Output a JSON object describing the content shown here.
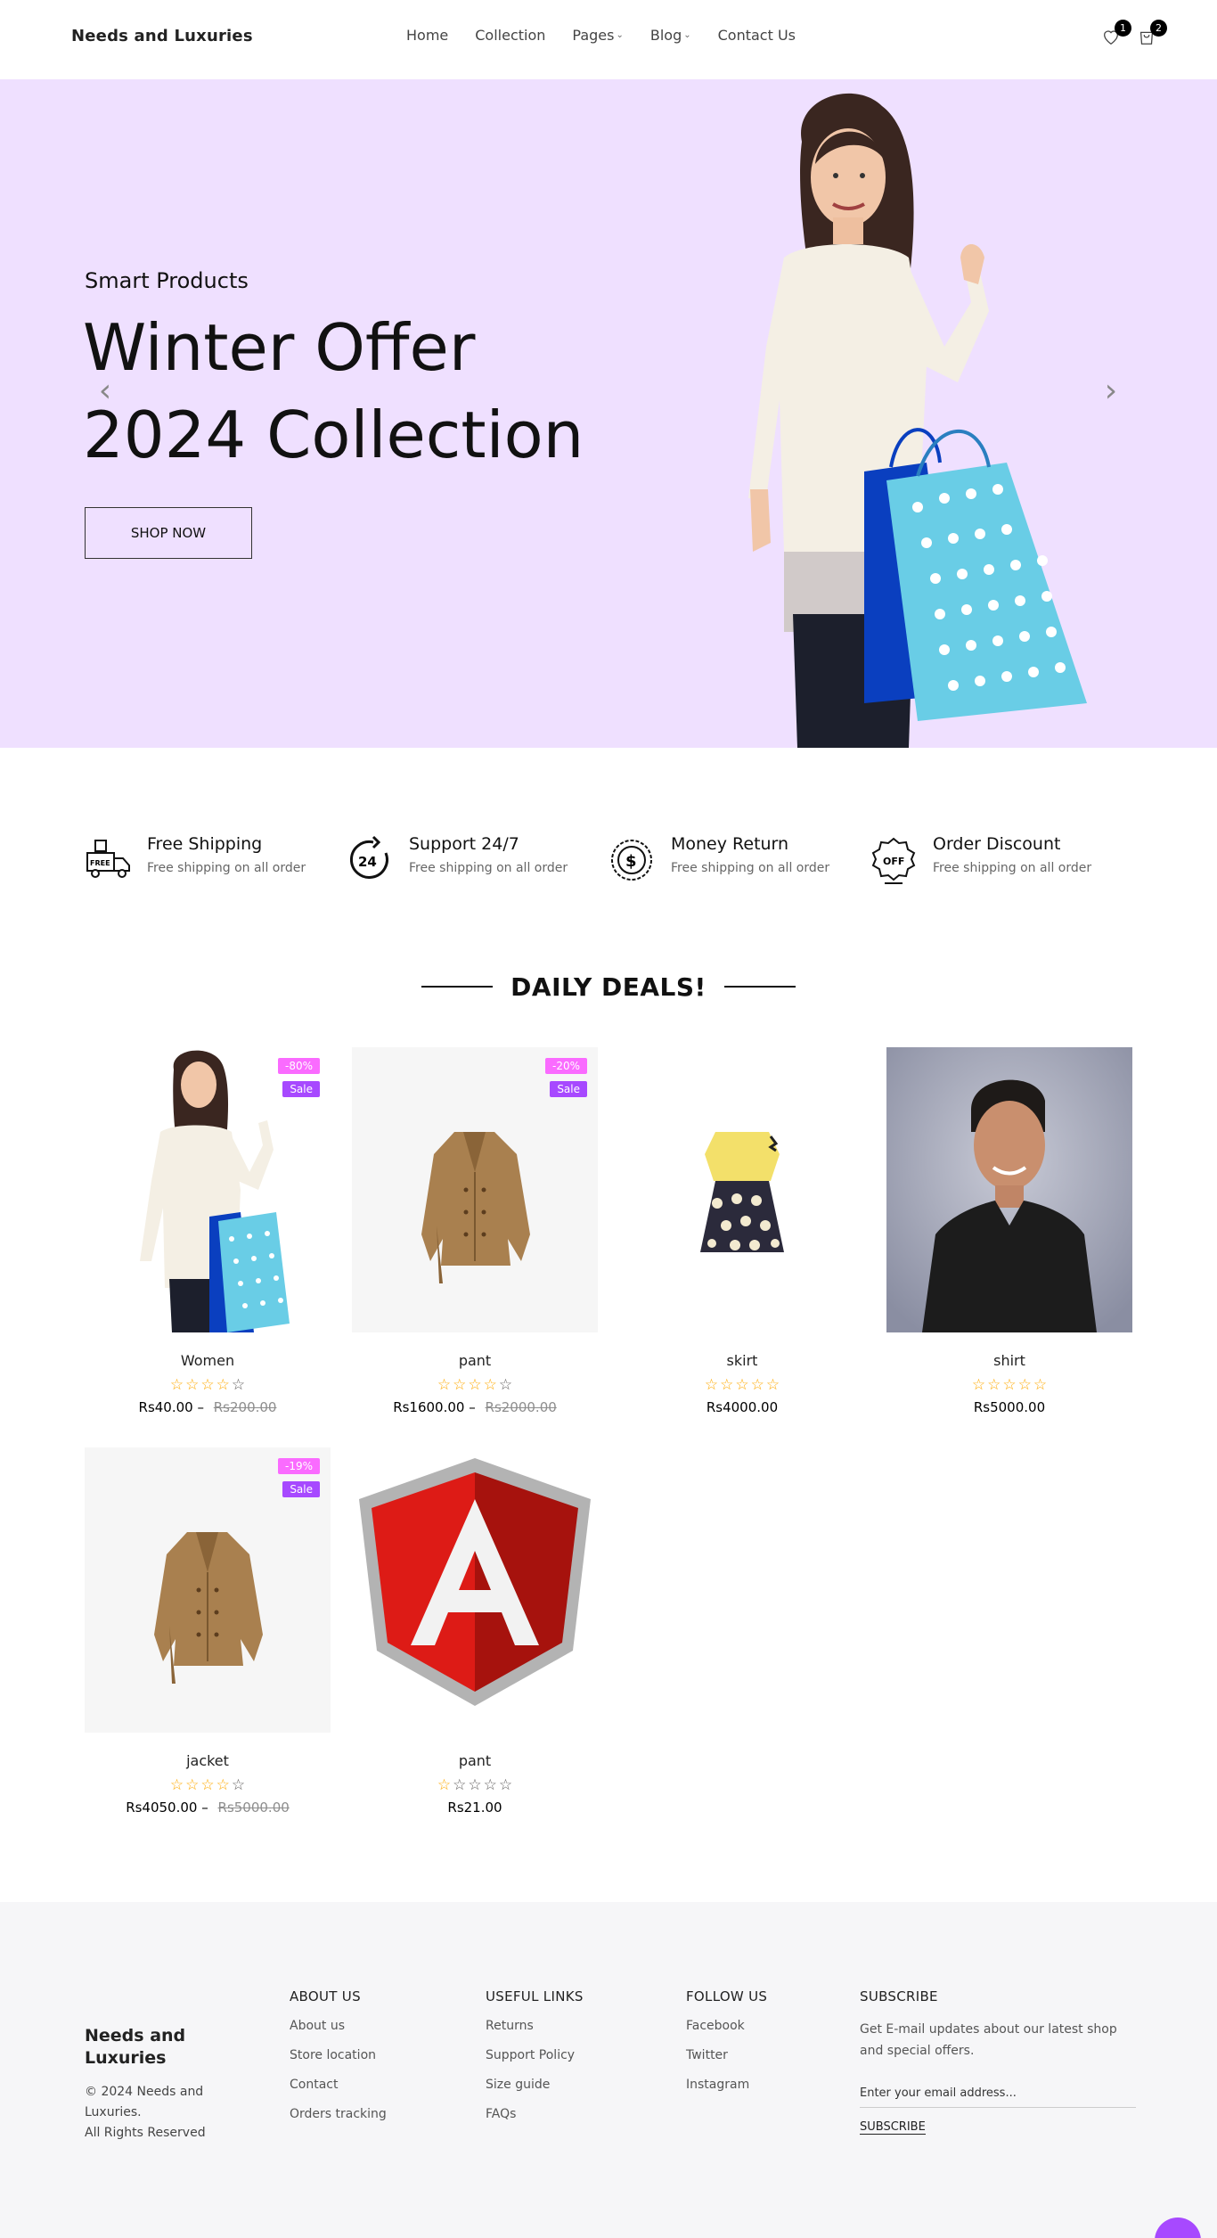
{
  "header": {
    "logo": "Needs and Luxuries",
    "nav": [
      {
        "label": "Home",
        "dropdown": false
      },
      {
        "label": "Collection",
        "dropdown": false
      },
      {
        "label": "Pages",
        "dropdown": true
      },
      {
        "label": "Blog",
        "dropdown": true
      },
      {
        "label": "Contact Us",
        "dropdown": false
      }
    ],
    "wishlist_count": "1",
    "cart_count": "2"
  },
  "hero": {
    "subtitle": "Smart Products",
    "title_line1": "Winter Offer",
    "title_line2": "2024 Collection",
    "button": "SHOP NOW",
    "background": "#efe0ff"
  },
  "features": [
    {
      "icon": "free-shipping-truck-icon",
      "title": "Free Shipping",
      "desc": "Free shipping on all order"
    },
    {
      "icon": "support-24-7-icon",
      "title": "Support 24/7",
      "desc": "Free shipping on all order"
    },
    {
      "icon": "money-return-icon",
      "title": "Money Return",
      "desc": "Free shipping on all order"
    },
    {
      "icon": "order-discount-icon",
      "title": "Order Discount",
      "desc": "Free shipping on all order"
    }
  ],
  "deals": {
    "heading": "DAILY DEALS!",
    "products": [
      {
        "name": "Women",
        "rating": 4,
        "price": "Rs40.00",
        "old_price": "Rs200.00",
        "discount": "-80%",
        "sale": "Sale",
        "image": "woman-with-shopping-bags"
      },
      {
        "name": "pant",
        "rating": 4,
        "price": "Rs1600.00",
        "old_price": "Rs2000.00",
        "discount": "-20%",
        "sale": "Sale",
        "image": "brown-coat"
      },
      {
        "name": "skirt",
        "rating": 5,
        "price": "Rs4000.00",
        "old_price": "",
        "discount": "",
        "sale": "",
        "image": "yellow-dress"
      },
      {
        "name": "shirt",
        "rating": 5,
        "price": "Rs5000.00",
        "old_price": "",
        "discount": "",
        "sale": "",
        "image": "person-portrait"
      },
      {
        "name": "jacket",
        "rating": 4,
        "price": "Rs4050.00",
        "old_price": "Rs5000.00",
        "discount": "-19%",
        "sale": "Sale",
        "image": "brown-coat"
      },
      {
        "name": "pant",
        "rating": 1,
        "price": "Rs21.00",
        "old_price": "",
        "discount": "",
        "sale": "",
        "image": "angular-logo"
      }
    ]
  },
  "footer": {
    "brand": "Needs and Luxuries",
    "copyright": "© 2024 Needs and Luxuries.",
    "rights": "All Rights Reserved",
    "about": {
      "title": "ABOUT US",
      "links": [
        "About us",
        "Store location",
        "Contact",
        "Orders tracking"
      ]
    },
    "useful": {
      "title": "USEFUL LINKS",
      "links": [
        "Returns",
        "Support Policy",
        "Size guide",
        "FAQs"
      ]
    },
    "follow": {
      "title": "FOLLOW US",
      "links": [
        "Facebook",
        "Twitter",
        "Instagram"
      ]
    },
    "subscribe": {
      "title": "SUBSCRIBE",
      "text": "Get E-mail updates about our latest shop and special offers.",
      "placeholder": "Enter your email address...",
      "button": "SUBSCRIBE"
    }
  }
}
